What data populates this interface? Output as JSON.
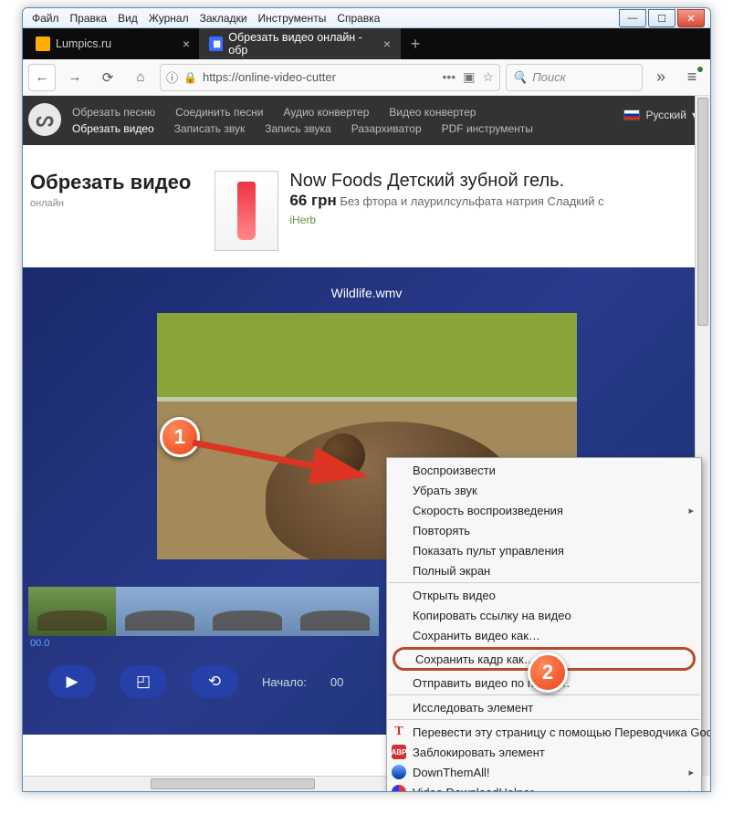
{
  "menubar": [
    "Файл",
    "Правка",
    "Вид",
    "Журнал",
    "Закладки",
    "Инструменты",
    "Справка"
  ],
  "tabs": [
    {
      "label": "Lumpics.ru",
      "active": false
    },
    {
      "label": "Обрезать видео онлайн - обр",
      "active": true
    }
  ],
  "url_bar": {
    "url_display": "https://online-video-cutter",
    "info_glyph": "ⓘ"
  },
  "search": {
    "placeholder": "Поиск",
    "glyph": "🔍"
  },
  "site_nav": {
    "row1": [
      "Обрезать песню",
      "Соединить песни",
      "Аудио конвертер",
      "Видео конвертер"
    ],
    "row2": [
      "Обрезать видео",
      "Записать звук",
      "Запись звука",
      "Разархиватор",
      "PDF инструменты"
    ],
    "active": "Обрезать видео",
    "lang": "Русский"
  },
  "page": {
    "title": "Обрезать видео",
    "subtitle": "онлайн"
  },
  "ad": {
    "title": "Now Foods Детский зубной гель.",
    "price": "66 грн",
    "desc": "Без фтора и лаурилсульфата натрия Сладкий с",
    "brand": "iHerb"
  },
  "video": {
    "filename": "Wildlife.wmv"
  },
  "timeline": {
    "start": "00.0"
  },
  "controls": {
    "start_label": "Начало:",
    "start_value": "00"
  },
  "context_menu": {
    "items": [
      {
        "label": "Воспроизвести"
      },
      {
        "label": "Убрать звук"
      },
      {
        "label": "Скорость воспроизведения",
        "sub": true
      },
      {
        "label": "Повторять"
      },
      {
        "label": "Показать пульт управления"
      },
      {
        "label": "Полный экран"
      },
      {
        "sep": true
      },
      {
        "label": "Открыть видео"
      },
      {
        "label": "Копировать ссылку на видео"
      },
      {
        "label": "Сохранить видео как…"
      },
      {
        "label": "Сохранить кадр как…",
        "highlight": true
      },
      {
        "label": "Отправить видео по почте…"
      },
      {
        "sep": true
      },
      {
        "label": "Исследовать элемент"
      },
      {
        "sep": true
      },
      {
        "label": "Перевести эту страницу с помощью Переводчика Google",
        "icon": "t"
      },
      {
        "label": "Заблокировать элемент",
        "icon": "abp"
      },
      {
        "label": "DownThemAll!",
        "icon": "dta",
        "sub": true
      },
      {
        "label": "Video DownloadHelper",
        "icon": "vdh",
        "sub": true
      }
    ]
  },
  "window_ctrls": {
    "min": "—",
    "max": "☐",
    "close": "✕"
  },
  "badges": {
    "one": "1",
    "two": "2"
  }
}
